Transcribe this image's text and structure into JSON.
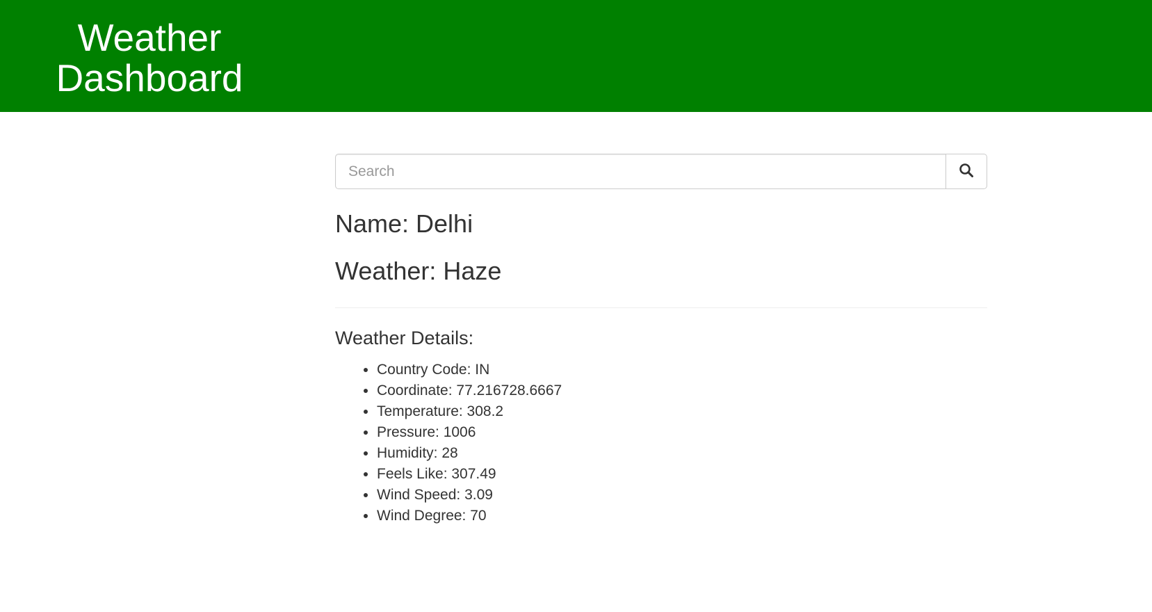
{
  "header": {
    "title_line1": "Weather",
    "title_line2": "Dashboard",
    "background_color": "#008000"
  },
  "search": {
    "placeholder": "Search",
    "value": "",
    "button_icon": "search-icon"
  },
  "city": {
    "label": "Name: Delhi"
  },
  "weather": {
    "label": "Weather: Haze"
  },
  "details": {
    "heading": "Weather Details:",
    "items": [
      "Country Code: IN",
      "Coordinate: 77.216728.6667",
      "Temperature: 308.2",
      "Pressure: 1006",
      "Humidity: 28",
      "Feels Like: 307.49",
      "Wind Speed: 3.09",
      "Wind Degree: 70"
    ]
  }
}
